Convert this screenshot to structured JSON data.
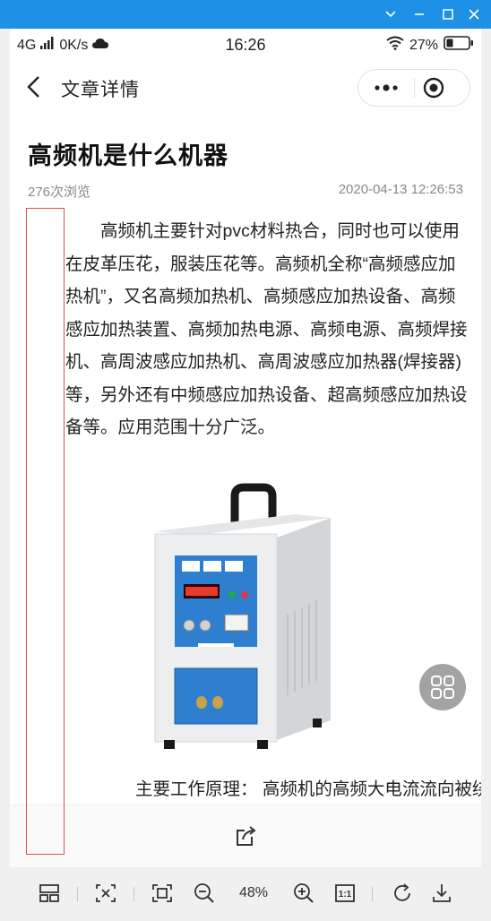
{
  "window": {
    "titlebar_color": "#1e90e6",
    "controls": [
      "chevron-down-icon",
      "minimize-icon",
      "maximize-icon",
      "close-icon"
    ]
  },
  "status_bar": {
    "network": "4G",
    "speed": "0K/s",
    "time": "16:26",
    "battery": "27%"
  },
  "nav": {
    "title": "文章详情"
  },
  "article": {
    "title": "高频机是什么机器",
    "views": "276次浏览",
    "date": "2020-04-13 12:26:53",
    "lines": [
      "　　高频机主要针对pvc材料热合，同时也可以使用",
      "在皮革压花，服装压花等。高频机全称“高频感应加",
      "热机”，又名高频加热机、高频感应加热设备、高频",
      "感应加热装置、高频加热电源、高频电源、高频焊接",
      "机、高周波感应加热机、高周波感应加热器(焊接器)",
      "等，另外还有中频感应加热设备、超高频感应加热设",
      "备等。应用范围十分广泛。"
    ],
    "subheading": "　　主要工作原理：  高频机的高频大电流流向被绕制"
  },
  "viewer_toolbar": {
    "zoom": "48%",
    "actual_size_label": "1:1"
  }
}
